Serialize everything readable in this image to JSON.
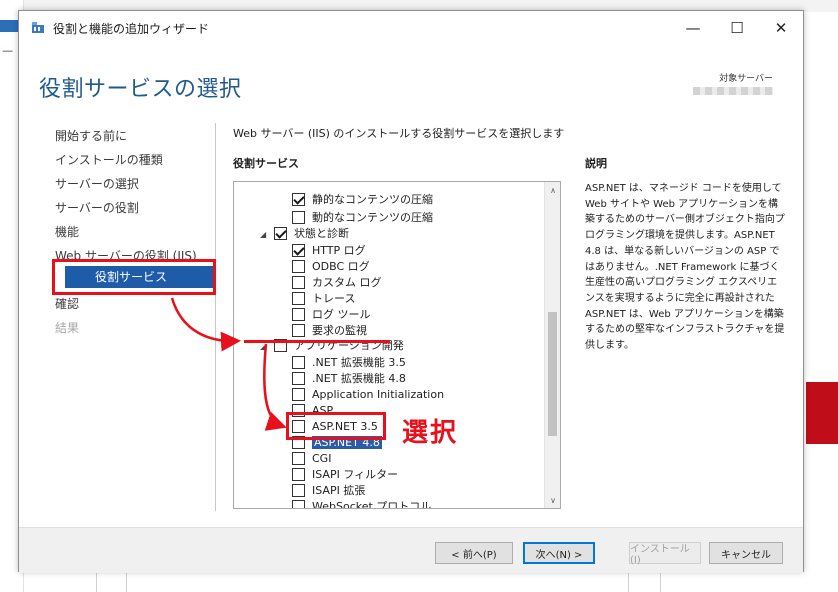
{
  "window": {
    "title": "役割と機能の追加ウィザード",
    "controls": [
      "minimize-icon",
      "maximize-icon",
      "close-icon"
    ]
  },
  "header": {
    "page_title": "役割サービスの選択",
    "target_server_label": "対象サーバー"
  },
  "steps": [
    {
      "label": "開始する前に",
      "state": "normal"
    },
    {
      "label": "インストールの種類",
      "state": "normal"
    },
    {
      "label": "サーバーの選択",
      "state": "normal"
    },
    {
      "label": "サーバーの役割",
      "state": "normal"
    },
    {
      "label": "機能",
      "state": "normal"
    },
    {
      "label": "Web サーバーの役割 (IIS)",
      "state": "normal"
    },
    {
      "label": "役割サービス",
      "state": "active"
    },
    {
      "label": "確認",
      "state": "normal"
    },
    {
      "label": "結果",
      "state": "disabled"
    }
  ],
  "main": {
    "instruction": "Web サーバー (IIS) のインストールする役割サービスを選択します",
    "section_title": "役割サービス",
    "tree": [
      {
        "label": "静的なコンテンツの圧縮",
        "checked": true,
        "level": 2
      },
      {
        "label": "動的なコンテンツの圧縮",
        "checked": false,
        "level": 2
      },
      {
        "label": "状態と診断",
        "checked": true,
        "level": 1,
        "expanded": true
      },
      {
        "label": "HTTP ログ",
        "checked": true,
        "level": 2
      },
      {
        "label": "ODBC ログ",
        "checked": false,
        "level": 2
      },
      {
        "label": "カスタム ログ",
        "checked": false,
        "level": 2
      },
      {
        "label": "トレース",
        "checked": false,
        "level": 2
      },
      {
        "label": "ログ ツール",
        "checked": false,
        "level": 2
      },
      {
        "label": "要求の監視",
        "checked": false,
        "level": 2
      },
      {
        "label": "アプリケーション開発",
        "checked": false,
        "level": 1,
        "expanded": true
      },
      {
        "label": ".NET 拡張機能 3.5",
        "checked": false,
        "level": 2
      },
      {
        "label": ".NET 拡張機能 4.8",
        "checked": false,
        "level": 2
      },
      {
        "label": "Application Initialization",
        "checked": false,
        "level": 2
      },
      {
        "label": "ASP",
        "checked": false,
        "level": 2
      },
      {
        "label": "ASP.NET 3.5",
        "checked": false,
        "level": 2
      },
      {
        "label": "ASP.NET 4.8",
        "checked": false,
        "level": 2,
        "selected": true
      },
      {
        "label": "CGI",
        "checked": false,
        "level": 2
      },
      {
        "label": "ISAPI フィルター",
        "checked": false,
        "level": 2
      },
      {
        "label": "ISAPI 拡張",
        "checked": false,
        "level": 2
      },
      {
        "label": "WebSocket プロトコル",
        "checked": false,
        "level": 2
      }
    ]
  },
  "description": {
    "title": "説明",
    "text": "ASP.NET は、マネージド コードを使用して Web サイトや Web アプリケーションを構築するためのサーバー側オブジェクト指向プログラミング環境を提供します。ASP.NET 4.8 は、単なる新しいバージョンの ASP ではありません。.NET Framework に基づく生産性の高いプログラミング エクスペリエンスを実現するように完全に再設計された ASP.NET は、Web アプリケーションを構築するための堅牢なインフラストラクチャを提供します。"
  },
  "footer": {
    "prev_label": "< 前へ(P)",
    "next_label": "次へ(N) >",
    "install_label": "インストール(I)",
    "cancel_label": "キャンセル"
  },
  "annotation": {
    "select_label": "選択",
    "color": "#e8101a"
  },
  "colors": {
    "accent": "#1e5ca9",
    "title": "#1f5a8c",
    "selection": "#2a5caa"
  }
}
